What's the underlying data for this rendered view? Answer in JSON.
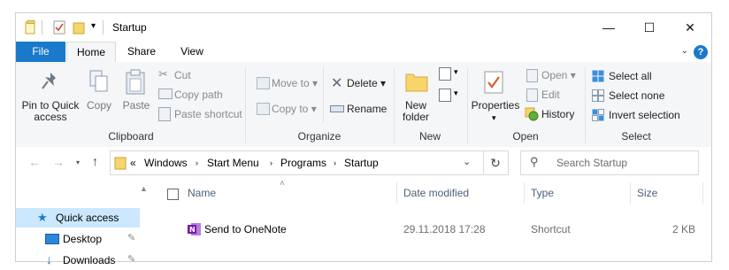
{
  "window": {
    "title": "Startup"
  },
  "qat": {
    "icons": [
      "folder-icon",
      "properties-check-icon",
      "new-folder-icon",
      "customize-chevron-icon"
    ]
  },
  "controls": {
    "minimize": "—",
    "maximize": "☐",
    "close": "✕"
  },
  "tabs": [
    {
      "label": "File"
    },
    {
      "label": "Home"
    },
    {
      "label": "Share"
    },
    {
      "label": "View"
    }
  ],
  "ribbon": {
    "clipboard": {
      "group_label": "Clipboard",
      "pin_label_1": "Pin to Quick",
      "pin_label_2": "access",
      "copy_label": "Copy",
      "paste_label": "Paste",
      "cut_label": "Cut",
      "copy_path_label": "Copy path",
      "paste_shortcut_label": "Paste shortcut"
    },
    "organize": {
      "group_label": "Organize",
      "move_to_label": "Move to",
      "copy_to_label": "Copy to",
      "delete_label": "Delete",
      "rename_label": "Rename"
    },
    "new": {
      "group_label": "New",
      "new_folder_label_1": "New",
      "new_folder_label_2": "folder"
    },
    "open": {
      "group_label": "Open",
      "properties_label": "Properties",
      "open_label": "Open",
      "edit_label": "Edit",
      "history_label": "History"
    },
    "select": {
      "group_label": "Select",
      "select_all_label": "Select all",
      "select_none_label": "Select none",
      "invert_label": "Invert selection"
    }
  },
  "address": {
    "overflow": "«",
    "crumbs": [
      "Windows",
      "Start Menu",
      "Programs",
      "Startup"
    ],
    "search_placeholder": "Search Startup"
  },
  "navpane": {
    "items": [
      {
        "label": "Quick access"
      },
      {
        "label": "Desktop"
      },
      {
        "label": "Downloads"
      }
    ]
  },
  "filelist": {
    "columns": {
      "name": "Name",
      "date": "Date modified",
      "type": "Type",
      "size": "Size"
    },
    "rows": [
      {
        "name": "Send to OneNote",
        "date": "29.11.2018 17:28",
        "type": "Shortcut",
        "size": "2 KB"
      }
    ]
  },
  "colors": {
    "accent": "#1979ca",
    "selection": "#cce8ff",
    "ribbon_bg": "#f5f6f7",
    "onenote": "#7719aa"
  }
}
